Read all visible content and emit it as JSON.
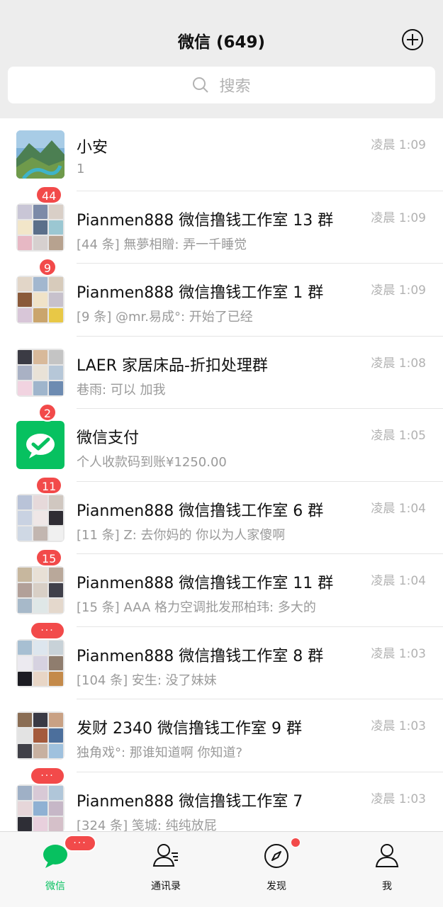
{
  "colors": {
    "accent": "#07c160",
    "badge": "#f24a4a",
    "background": "#ededed",
    "text_secondary": "#9a9a9a"
  },
  "header": {
    "title": "微信 (649)",
    "add_icon": "plus-circle-icon"
  },
  "search": {
    "placeholder": "搜索",
    "icon": "search-icon"
  },
  "chats": [
    {
      "name": "小安",
      "time": "凌晨 1:09",
      "preview": "1",
      "badge": ""
    },
    {
      "name": "Pianmen888 微信撸钱工作室 13 群",
      "time": "凌晨 1:09",
      "preview": "[44 条] 無夢相贈: 弄一千睡觉",
      "badge": "44"
    },
    {
      "name": "Pianmen888 微信撸钱工作室 1 群",
      "time": "凌晨 1:09",
      "preview": "[9 条] @mr.易成°: 开始了已经",
      "badge": "9"
    },
    {
      "name": "LAER 家居床品-折扣处理群",
      "time": "凌晨 1:08",
      "preview": "巷雨: 可以 加我",
      "badge": ""
    },
    {
      "name": "微信支付",
      "time": "凌晨 1:05",
      "preview": "个人收款码到账¥1250.00",
      "badge": "2"
    },
    {
      "name": "Pianmen888 微信撸钱工作室 6 群",
      "time": "凌晨 1:04",
      "preview": "[11 条] Z: 去你妈的 你以为人家傻啊",
      "badge": "11"
    },
    {
      "name": "Pianmen888 微信撸钱工作室 11 群",
      "time": "凌晨 1:04",
      "preview": "[15 条] AAA 格力空调批发邢柏玮: 多大的",
      "badge": "15"
    },
    {
      "name": "Pianmen888 微信撸钱工作室 8 群",
      "time": "凌晨 1:03",
      "preview": "[104 条] 安生: 没了妹妹",
      "badge": "···"
    },
    {
      "name": "发财 2340 微信撸钱工作室 9 群",
      "time": "凌晨 1:03",
      "preview": "独角戏°: 那谁知道啊 你知道?",
      "badge": ""
    },
    {
      "name": "Pianmen888 微信撸钱工作室 7",
      "time": "凌晨 1:03",
      "preview": "[324 条] 笺城: 纯纯放屁",
      "badge": "···"
    }
  ],
  "tabs": [
    {
      "label": "微信",
      "icon": "chat-bubble-icon",
      "badge": "···"
    },
    {
      "label": "通讯录",
      "icon": "contacts-icon",
      "badge": ""
    },
    {
      "label": "发现",
      "icon": "compass-icon",
      "badge": "dot"
    },
    {
      "label": "我",
      "icon": "person-icon",
      "badge": ""
    }
  ]
}
